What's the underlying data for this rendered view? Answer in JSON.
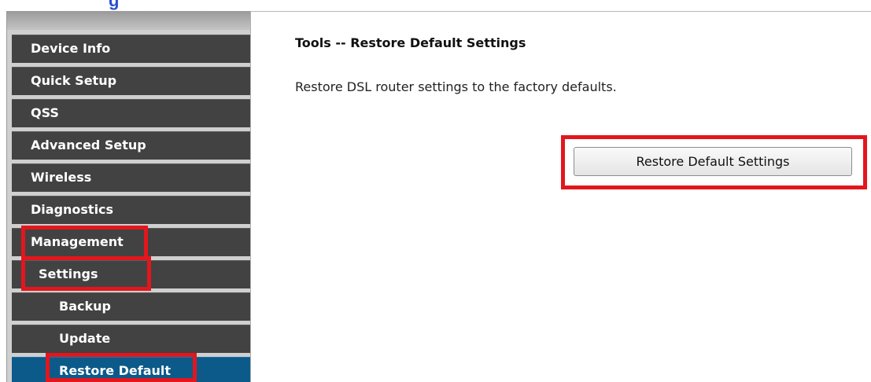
{
  "header": {
    "title_fragment": "g"
  },
  "sidebar": {
    "items": [
      {
        "label": "Device Info",
        "level": 0,
        "active": false
      },
      {
        "label": "Quick Setup",
        "level": 0,
        "active": false
      },
      {
        "label": "QSS",
        "level": 0,
        "active": false
      },
      {
        "label": "Advanced Setup",
        "level": 0,
        "active": false
      },
      {
        "label": "Wireless",
        "level": 0,
        "active": false
      },
      {
        "label": "Diagnostics",
        "level": 0,
        "active": false
      },
      {
        "label": "Management",
        "level": 0,
        "active": false,
        "highlighted": true
      },
      {
        "label": "Settings",
        "level": 1,
        "active": false,
        "highlighted": true
      },
      {
        "label": "Backup",
        "level": 2,
        "active": false
      },
      {
        "label": "Update",
        "level": 2,
        "active": false
      },
      {
        "label": "Restore Default",
        "level": 2,
        "active": true,
        "highlighted": true
      }
    ]
  },
  "main": {
    "title": "Tools -- Restore Default Settings",
    "description": "Restore DSL router settings to the factory defaults.",
    "restore_button_label": "Restore Default Settings"
  },
  "colors": {
    "nav_background": "#424242",
    "nav_active_background": "#0b5a8a",
    "highlight_border": "#e3161d",
    "header_fragment": "#2a4fd0"
  }
}
